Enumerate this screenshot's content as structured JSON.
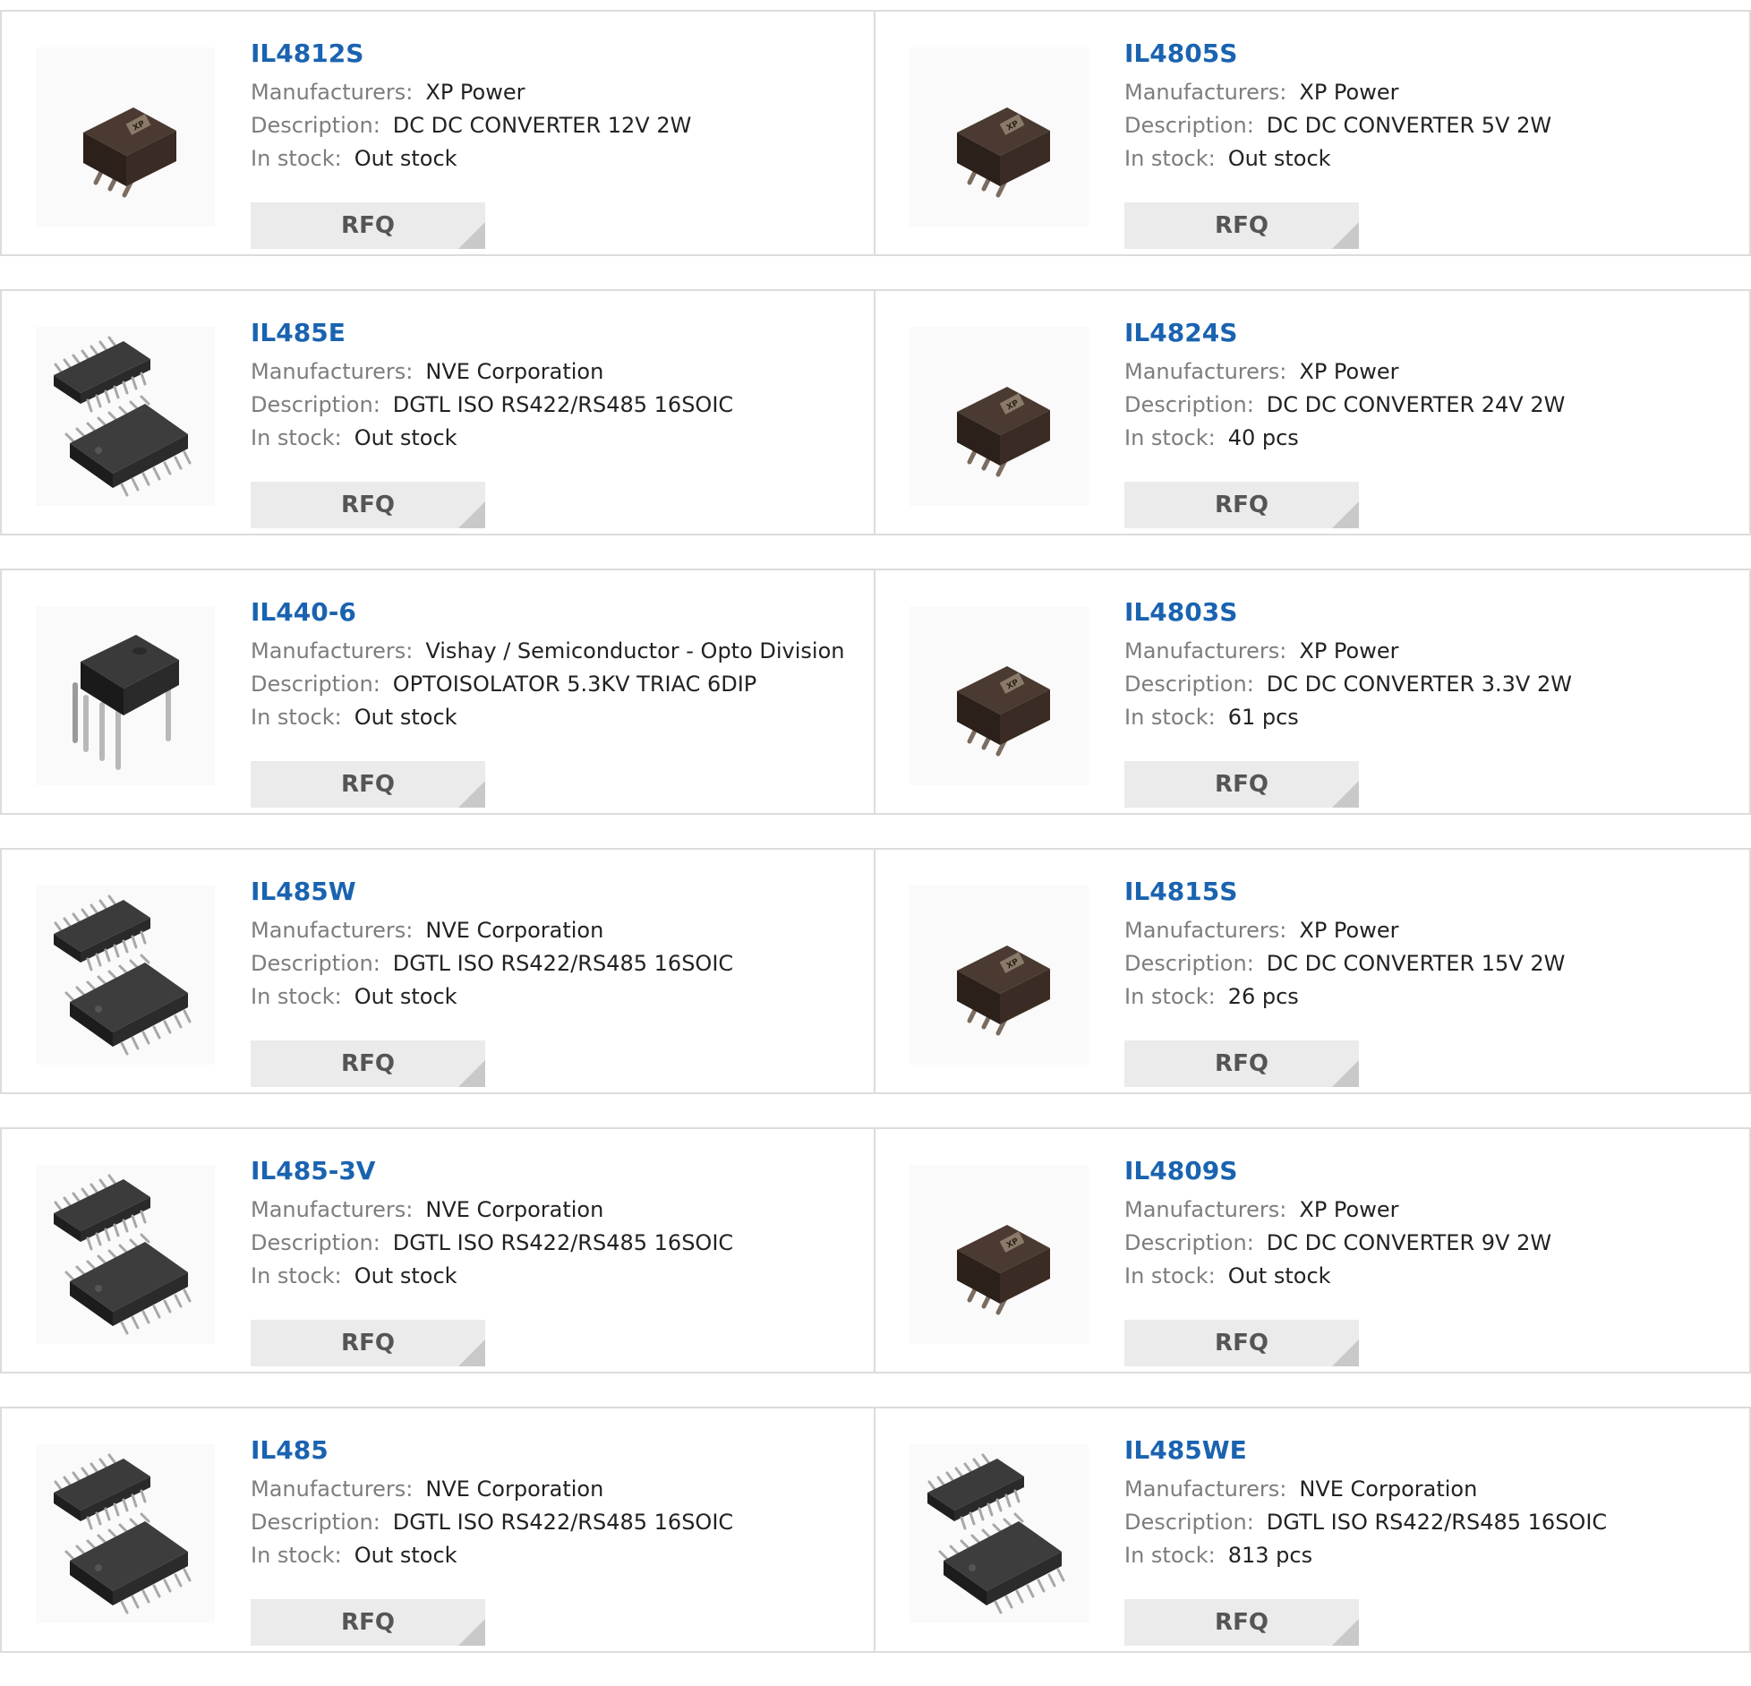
{
  "labels": {
    "manufacturers": "Manufacturers:",
    "description": "Description:",
    "in_stock": "In stock:",
    "rfq": "RFQ"
  },
  "colors": {
    "part_link": "#1a63b0",
    "label": "#7d7d7d",
    "value": "#222222",
    "rfq_bg": "#ebebeb",
    "card_border": "#dcdcdc"
  },
  "products": [
    {
      "part": "IL4812S",
      "manufacturer": "XP Power",
      "description": "DC DC CONVERTER 12V 2W",
      "stock": "Out stock",
      "image": "dc-converter-module-icon"
    },
    {
      "part": "IL4805S",
      "manufacturer": "XP Power",
      "description": "DC DC CONVERTER 5V 2W",
      "stock": "Out stock",
      "image": "dc-converter-module-icon"
    },
    {
      "part": "IL485E",
      "manufacturer": "NVE Corporation",
      "description": "DGTL ISO RS422/RS485 16SOIC",
      "stock": "Out stock",
      "image": "soic-chip-icon"
    },
    {
      "part": "IL4824S",
      "manufacturer": "XP Power",
      "description": "DC DC CONVERTER 24V 2W",
      "stock": "40 pcs",
      "image": "dc-converter-module-icon"
    },
    {
      "part": "IL440-6",
      "manufacturer": "Vishay / Semiconductor - Opto Division",
      "description": "OPTOISOLATOR 5.3KV TRIAC 6DIP",
      "stock": "Out stock",
      "image": "dip-chip-icon"
    },
    {
      "part": "IL4803S",
      "manufacturer": "XP Power",
      "description": "DC DC CONVERTER 3.3V 2W",
      "stock": "61 pcs",
      "image": "dc-converter-module-icon"
    },
    {
      "part": "IL485W",
      "manufacturer": "NVE Corporation",
      "description": "DGTL ISO RS422/RS485 16SOIC",
      "stock": "Out stock",
      "image": "soic-chip-icon"
    },
    {
      "part": "IL4815S",
      "manufacturer": "XP Power",
      "description": "DC DC CONVERTER 15V 2W",
      "stock": "26 pcs",
      "image": "dc-converter-module-icon"
    },
    {
      "part": "IL485-3V",
      "manufacturer": "NVE Corporation",
      "description": "DGTL ISO RS422/RS485 16SOIC",
      "stock": "Out stock",
      "image": "soic-chip-icon"
    },
    {
      "part": "IL4809S",
      "manufacturer": "XP Power",
      "description": "DC DC CONVERTER 9V 2W",
      "stock": "Out stock",
      "image": "dc-converter-module-icon"
    },
    {
      "part": "IL485",
      "manufacturer": "NVE Corporation",
      "description": "DGTL ISO RS422/RS485 16SOIC",
      "stock": "Out stock",
      "image": "soic-chip-icon"
    },
    {
      "part": "IL485WE",
      "manufacturer": "NVE Corporation",
      "description": "DGTL ISO RS422/RS485 16SOIC",
      "stock": "813 pcs",
      "image": "soic-chip-icon"
    }
  ]
}
